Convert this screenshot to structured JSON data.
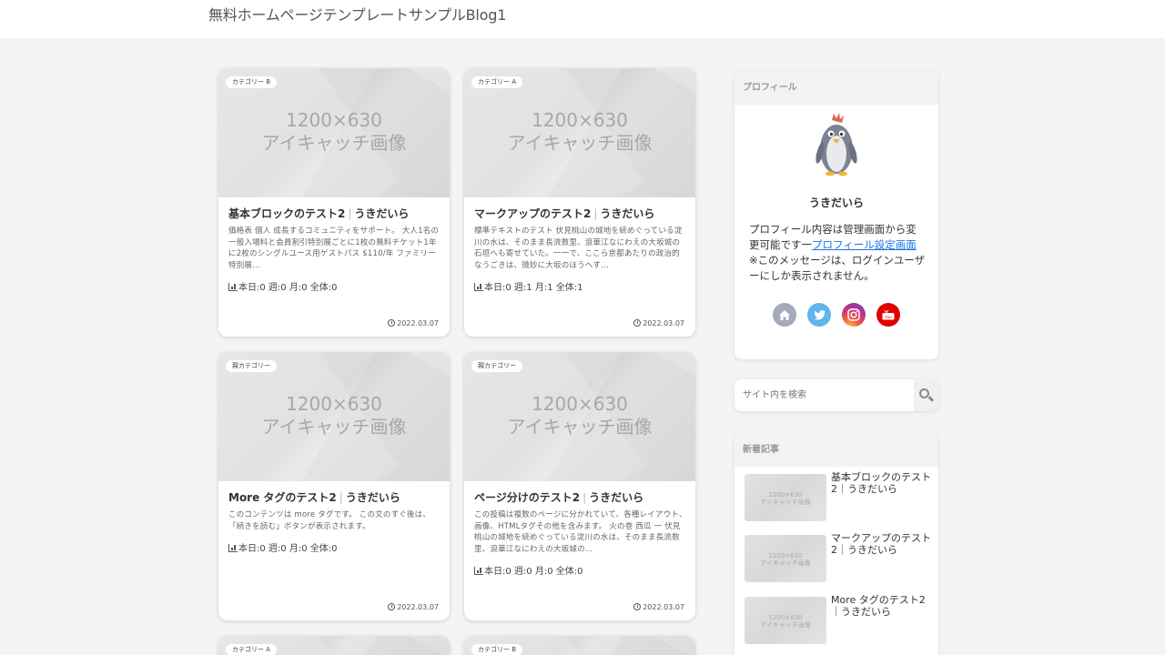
{
  "site": {
    "title": "無料ホームページテンプレートサンプルBlog1"
  },
  "thumbnail": {
    "line1": "1200×630",
    "line2": "アイキャッチ画像"
  },
  "cards": [
    {
      "category": "カテゴリー B",
      "title": "基本ブロックのテスト2",
      "author": "うきだいら",
      "excerpt": "価格表 個人 成長するコミュニティをサポート。 大人1名の一般入場料と会員割引特別展ごとに1枚の無料チケット1年に2枚のシングルユース用ゲストパス $110/年 ファミリー 特別展…",
      "stats": "本日:0  週:0  月:0  全体:0",
      "date": "2022.03.07"
    },
    {
      "category": "カテゴリー A",
      "title": "マークアップのテスト2",
      "author": "うきだいら",
      "excerpt": "標準テキストのテスト 伏見桃山の城地を続めぐっている淀川の水は、そのまま長流数里、浪華江なにわえの大坂城の石垣へも寄せていた。一一で、ここら京都あたりの政治的なうごきは、微妙に大坂のほうへす…",
      "stats": "本日:0  週:1  月:1  全体:1",
      "date": "2022.03.07"
    },
    {
      "category": "親カテゴリー",
      "title": "More タグのテスト2",
      "author": "うきだいら",
      "excerpt": "このコンテンツは more タグです。 この文のすぐ後は、「続きを読む」ボタンが表示されます。",
      "stats": "本日:0  週:0  月:0  全体:0",
      "date": "2022.03.07"
    },
    {
      "category": "親カテゴリー",
      "title": "ページ分けのテスト2",
      "author": "うきだいら",
      "excerpt": "この投稿は複数のページに分かれていて、各種レイアウト、画像、HTMLタグその他を含みます。 火の巻 西瓜 一 伏見桃山の城地を続めぐっている淀川の水は、そのまま長流数里、浪華江なにわえの大坂城の…",
      "stats": "本日:0  週:0  月:0  全体:0",
      "date": "2022.03.07"
    },
    {
      "category": "カテゴリー A"
    },
    {
      "category": "カテゴリー B"
    }
  ],
  "profile": {
    "heading": "プロフィール",
    "name": "うきだいら",
    "text_before": "プロフィール内容は管理画面から変更可能です一",
    "link_text": "プロフィール設定画面",
    "text_after": "※このメッセージは、ログインユーザーにしか表示されません。",
    "social": [
      {
        "icon": "home-icon",
        "color": "#a6a9b8"
      },
      {
        "icon": "twitter-icon",
        "color": "#5eb6ec"
      },
      {
        "icon": "instagram-icon",
        "color": "#c13584"
      },
      {
        "icon": "youtube-icon",
        "color": "#e00000"
      }
    ]
  },
  "search": {
    "placeholder": "サイト内を検索"
  },
  "recent": {
    "heading": "新着記事",
    "items": [
      {
        "title": "基本ブロックのテスト2｜うきだいら"
      },
      {
        "title": "マークアップのテスト2｜うきだいら"
      },
      {
        "title": "More タグのテスト2｜うきだいら"
      }
    ]
  }
}
